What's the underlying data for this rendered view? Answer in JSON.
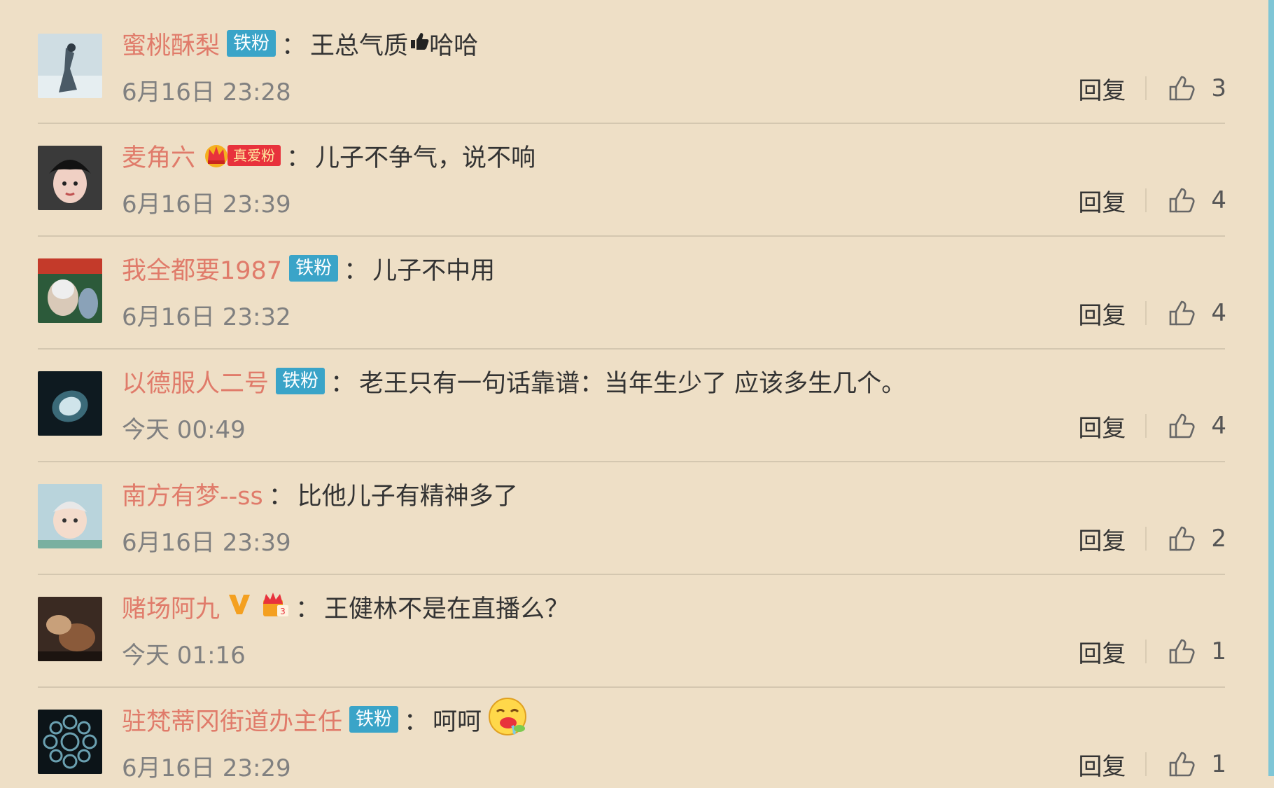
{
  "comments": [
    {
      "username": "蜜桃酥梨",
      "badge": "铁粉",
      "text": "王总气质",
      "text_after": "哈哈",
      "time": "6月16日 23:28",
      "reply": "回复",
      "likes": "3"
    },
    {
      "username": "麦角六",
      "badge": "真爱粉",
      "text": "儿子不争气，说不响",
      "time": "6月16日 23:39",
      "reply": "回复",
      "likes": "4"
    },
    {
      "username": "我全都要1987",
      "badge": "铁粉",
      "text": "儿子不中用",
      "time": "6月16日 23:32",
      "reply": "回复",
      "likes": "4"
    },
    {
      "username": "以德服人二号",
      "badge": "铁粉",
      "text": "老王只有一句话靠谱：当年生少了  应该多生几个。",
      "time": "今天 00:49",
      "reply": "回复",
      "likes": "4"
    },
    {
      "username": "南方有梦--ss",
      "text": "比他儿子有精神多了",
      "time": "6月16日 23:39",
      "reply": "回复",
      "likes": "2"
    },
    {
      "username": "赌场阿九",
      "text": "王健林不是在直播么？",
      "time": "今天 01:16",
      "reply": "回复",
      "likes": "1"
    },
    {
      "username": "驻梵蒂冈街道办主任",
      "badge": "铁粉",
      "text": "呵呵",
      "time": "6月16日 23:29",
      "reply": "回复",
      "likes": "1"
    }
  ],
  "colon": "："
}
